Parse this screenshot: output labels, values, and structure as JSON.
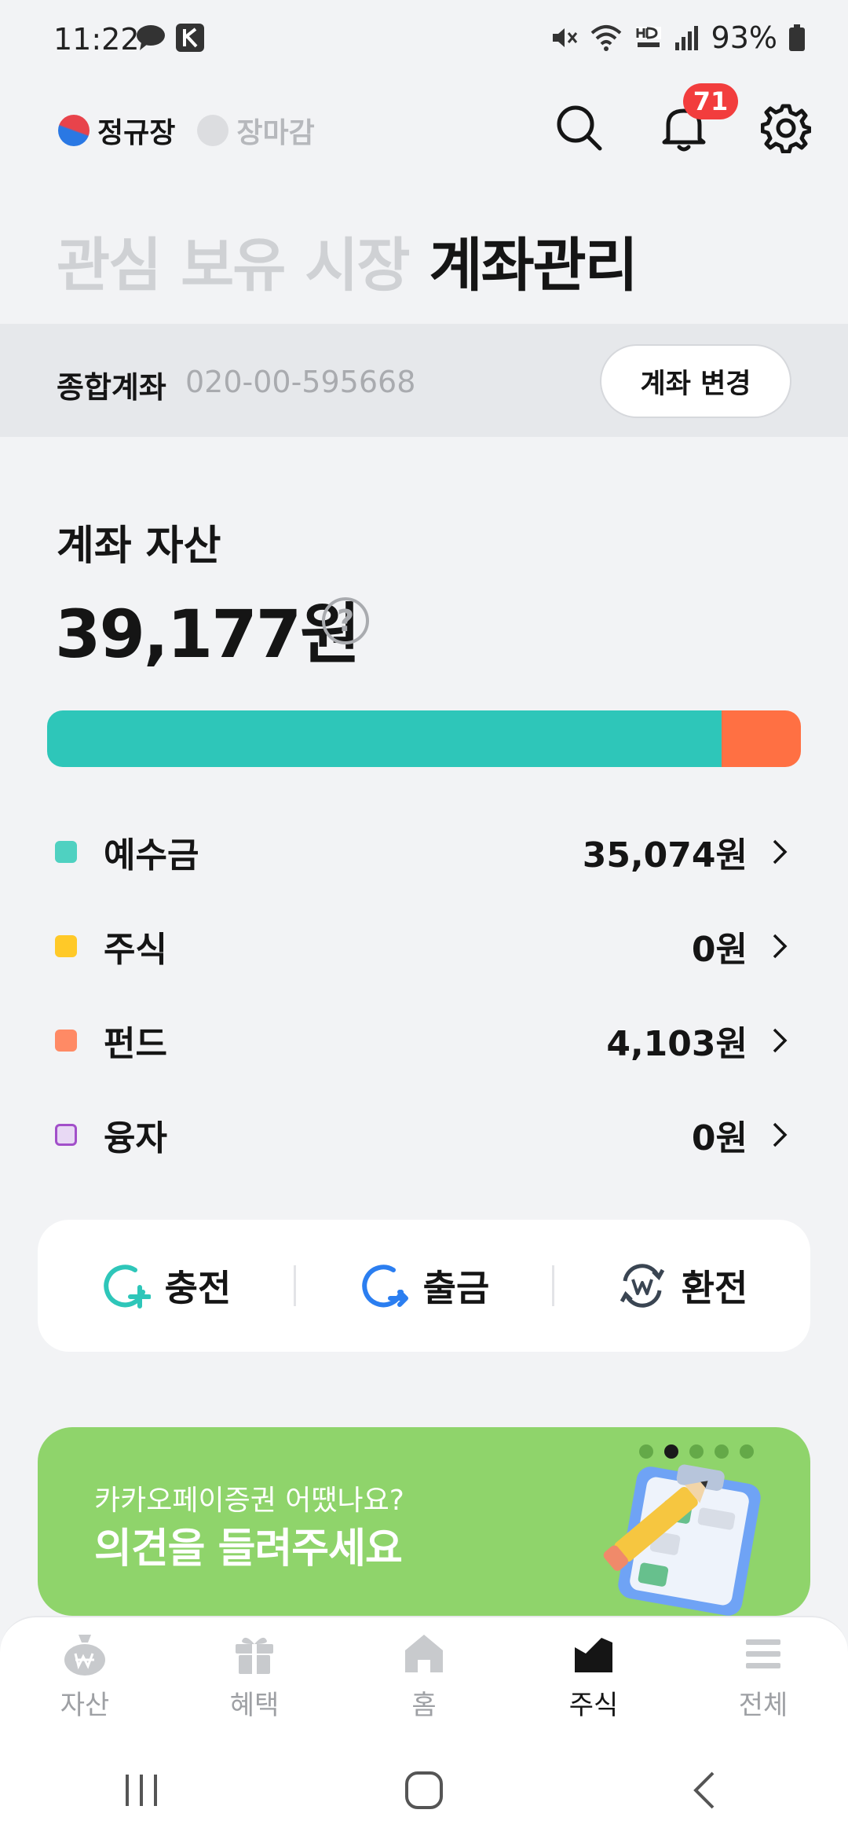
{
  "status_bar": {
    "time": "11:22",
    "battery": "93%"
  },
  "header": {
    "market_open": "정규장",
    "market_closed": "장마감",
    "notification_count": "71",
    "icons": [
      "search-icon",
      "bell-icon",
      "gear-icon"
    ]
  },
  "tabs": [
    {
      "label": "관심"
    },
    {
      "label": "보유"
    },
    {
      "label": "시장"
    },
    {
      "label": "계좌관리"
    }
  ],
  "account": {
    "type": "종합계좌",
    "number": "020-00-595668",
    "change_label": "계좌 변경"
  },
  "assets": {
    "title": "계좌 자산",
    "total": "39,177원",
    "help_symbol": "?",
    "rows": [
      {
        "label": "예수금",
        "value": "35,074원",
        "color": "#4fd1c1"
      },
      {
        "label": "주식",
        "value": "0원",
        "color": "#ffc928"
      },
      {
        "label": "펀드",
        "value": "4,103원",
        "color": "#ff8a65"
      },
      {
        "label": "융자",
        "value": "0원",
        "color": "#e8d9f4"
      }
    ],
    "bar": {
      "deposit_color": "#2ec6b9",
      "fund_color": "#ff7043",
      "deposit_fraction": 0.895,
      "fund_fraction": 0.105
    }
  },
  "actions": [
    {
      "label": "충전",
      "icon": "charge-icon"
    },
    {
      "label": "출금",
      "icon": "withdraw-icon"
    },
    {
      "label": "환전",
      "icon": "exchange-icon"
    }
  ],
  "banner": {
    "subtitle": "카카오페이증권 어땠나요?",
    "title": "의견을 들려주세요",
    "page_count": 5,
    "active_page": 2,
    "bg_color": "#8fd46b"
  },
  "bottom_nav": [
    {
      "label": "자산",
      "icon": "money-bag-icon"
    },
    {
      "label": "혜택",
      "icon": "gift-icon"
    },
    {
      "label": "홈",
      "icon": "home-icon"
    },
    {
      "label": "주식",
      "icon": "stock-icon",
      "active": true
    },
    {
      "label": "전체",
      "icon": "menu-icon"
    }
  ]
}
